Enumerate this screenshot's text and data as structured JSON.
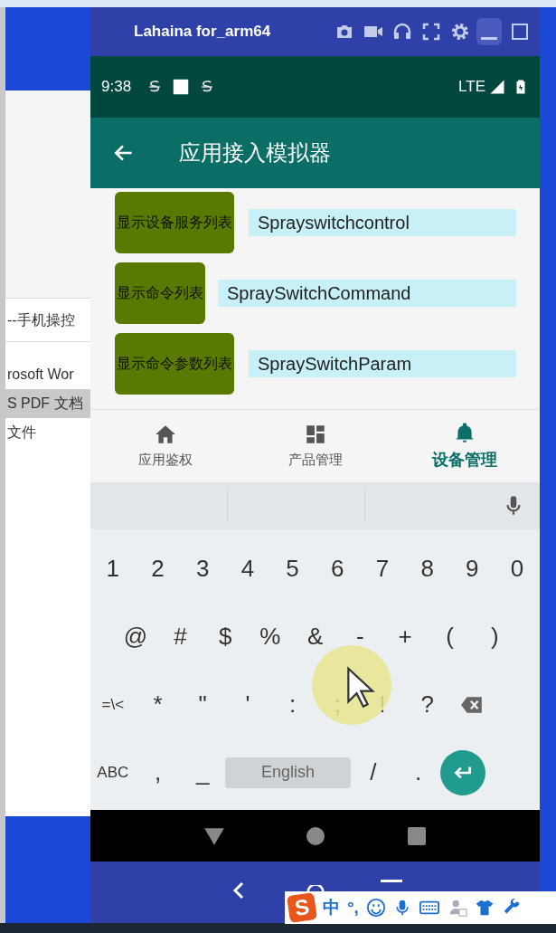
{
  "desktop_window": {
    "items": [
      {
        "label": "--手机操控",
        "selected": false
      },
      {
        "label": "rosoft Wor",
        "selected": false
      },
      {
        "label": "S PDF 文档",
        "selected": true
      },
      {
        "label": "文件",
        "selected": false
      }
    ]
  },
  "emulator": {
    "title": "Lahaina for_arm64"
  },
  "status_bar": {
    "time": "9:38",
    "network": "LTE"
  },
  "app_bar": {
    "title": "应用接入模拟器"
  },
  "rows": [
    {
      "button": "显示设备服务列表",
      "value": "Sprayswitchcontrol"
    },
    {
      "button": "显示命令列表",
      "value": "SpraySwitchCommand"
    },
    {
      "button": "显示命令参数列表",
      "value": "SpraySwitchParam"
    }
  ],
  "bottom_nav": [
    {
      "label": "应用鉴权",
      "kind": "home",
      "selected": false
    },
    {
      "label": "产品管理",
      "kind": "dashboard",
      "selected": false
    },
    {
      "label": "设备管理",
      "kind": "bell",
      "selected": true
    }
  ],
  "keyboard": {
    "rows": [
      [
        {
          "kind": "char",
          "label": "1"
        },
        {
          "kind": "char",
          "label": "2"
        },
        {
          "kind": "char",
          "label": "3"
        },
        {
          "kind": "char",
          "label": "4"
        },
        {
          "kind": "char",
          "label": "5"
        },
        {
          "kind": "char",
          "label": "6"
        },
        {
          "kind": "char",
          "label": "7"
        },
        {
          "kind": "char",
          "label": "8"
        },
        {
          "kind": "char",
          "label": "9"
        },
        {
          "kind": "char",
          "label": "0"
        }
      ],
      [
        {
          "kind": "char",
          "label": "@"
        },
        {
          "kind": "char",
          "label": "#"
        },
        {
          "kind": "char",
          "label": "$"
        },
        {
          "kind": "char",
          "label": "%"
        },
        {
          "kind": "char",
          "label": "&"
        },
        {
          "kind": "char",
          "label": "-"
        },
        {
          "kind": "char",
          "label": "+"
        },
        {
          "kind": "char",
          "label": "("
        },
        {
          "kind": "char",
          "label": ")"
        }
      ],
      [
        {
          "kind": "mode",
          "label": "=\\<"
        },
        {
          "kind": "char",
          "label": "*"
        },
        {
          "kind": "char",
          "label": "\""
        },
        {
          "kind": "char",
          "label": "'"
        },
        {
          "kind": "char",
          "label": ":"
        },
        {
          "kind": "char",
          "label": ";"
        },
        {
          "kind": "char",
          "label": "!"
        },
        {
          "kind": "char",
          "label": "?"
        },
        {
          "kind": "backspace"
        }
      ],
      [
        {
          "kind": "mode",
          "label": "ABC"
        },
        {
          "kind": "char",
          "label": ","
        },
        {
          "kind": "char",
          "label": "_"
        },
        {
          "kind": "space",
          "label": "English"
        },
        {
          "kind": "char",
          "label": "/"
        },
        {
          "kind": "char",
          "label": "."
        },
        {
          "kind": "enter"
        }
      ]
    ]
  },
  "ime_toolbar": {
    "logo": "S",
    "mode": "中",
    "punctuation": "°,"
  }
}
